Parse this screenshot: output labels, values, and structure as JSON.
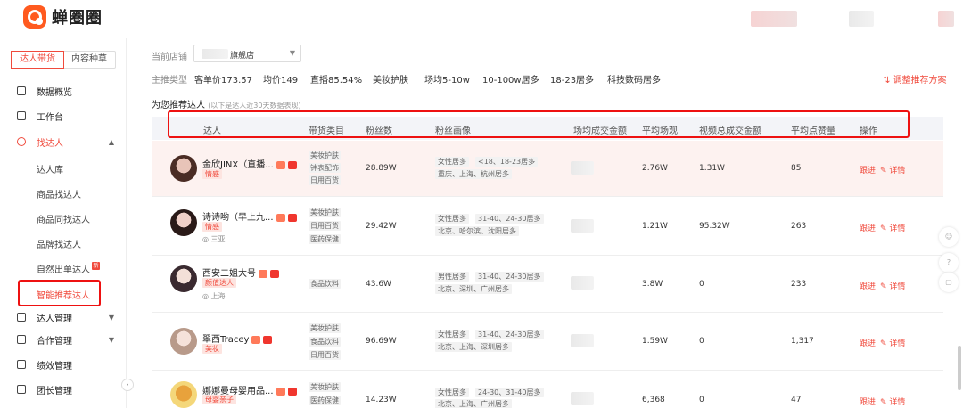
{
  "app": {
    "name": "蝉圈圈"
  },
  "sidebar": {
    "tabs": [
      "达人带货",
      "内容种草"
    ],
    "nav": [
      {
        "label": "数据概览",
        "icon": "gauge-icon"
      },
      {
        "label": "工作台",
        "icon": "monitor-icon"
      },
      {
        "label": "找达人",
        "icon": "search-person-icon"
      },
      {
        "label": "达人管理",
        "icon": "person-icon"
      },
      {
        "label": "合作管理",
        "icon": "cooperation-icon"
      },
      {
        "label": "绩效管理",
        "icon": "chart-icon"
      },
      {
        "label": "团长管理",
        "icon": "team-icon"
      }
    ],
    "sub": [
      "达人库",
      "商品找达人",
      "商品同找达人",
      "品牌找达人",
      "自然出单达人",
      "智能推荐达人"
    ],
    "sub_badge": "新"
  },
  "filters": {
    "store_label": "当前店铺",
    "store_value": "旗舰店",
    "main_label": "主推类型",
    "items": [
      "客单价173.57",
      "均价149",
      "直播85.54%",
      "美妆护肤",
      "场均5-10w",
      "10-100w居多",
      "18-23居多",
      "科技数码居多"
    ],
    "adjust_link": "调整推荐方案"
  },
  "section": {
    "title": "为您推荐达人",
    "note": "(以下是达人近30天数据表现)"
  },
  "table": {
    "headers": [
      "达人",
      "带货类目",
      "粉丝数",
      "粉丝画像",
      "场均成交金额",
      "平均场观",
      "视频总成交金额",
      "平均点赞量",
      "操作"
    ],
    "rows": [
      {
        "name": "金欣JINX（直播...",
        "tag": "情感",
        "loc": "",
        "cats": [
          "美妆护肤",
          "钟表配饰",
          "日用百货"
        ],
        "fans": "28.89W",
        "fan1": [
          "女性居多",
          "<18、18-23居多"
        ],
        "fan2": [
          "重庆、上海、杭州居多"
        ],
        "avg_view": "2.76W",
        "video_gmv": "1.31W",
        "avg_like": "85"
      },
      {
        "name": "诗诗哟（早上九...",
        "tag": "情感",
        "loc": "三亚",
        "cats": [
          "美妆护肤",
          "日用百货",
          "医药保健"
        ],
        "fans": "29.42W",
        "fan1": [
          "女性居多",
          "31-40、24-30居多"
        ],
        "fan2": [
          "北京、哈尔滨、沈阳居多"
        ],
        "avg_view": "1.21W",
        "video_gmv": "95.32W",
        "avg_like": "263"
      },
      {
        "name": "西安二姐大号",
        "tag": "颜值达人",
        "loc": "上海",
        "cats": [
          "食品饮料"
        ],
        "fans": "43.6W",
        "fan1": [
          "男性居多",
          "31-40、24-30居多"
        ],
        "fan2": [
          "北京、深圳、广州居多"
        ],
        "avg_view": "3.8W",
        "video_gmv": "0",
        "avg_like": "233"
      },
      {
        "name": "翠西Tracey",
        "tag": "美妆",
        "loc": "",
        "cats": [
          "美妆护肤",
          "食品饮料",
          "日用百货"
        ],
        "fans": "96.69W",
        "fan1": [
          "女性居多",
          "31-40、24-30居多"
        ],
        "fan2": [
          "北京、上海、深圳居多"
        ],
        "avg_view": "1.59W",
        "video_gmv": "0",
        "avg_like": "1,317"
      },
      {
        "name": "娜娜曼母婴用品...",
        "tag": "母婴亲子",
        "loc": "",
        "cats": [
          "美妆护肤",
          "医药保健"
        ],
        "fans": "14.23W",
        "fan1": [
          "女性居多",
          "24-30、31-40居多"
        ],
        "fan2": [
          "北京、上海、广州居多"
        ],
        "avg_view": "6,368",
        "video_gmv": "0",
        "avg_like": "47"
      }
    ],
    "op_follow": "跟进",
    "op_detail": "详情"
  },
  "colors": {
    "accent": "#f04a3c",
    "annotation": "#e11111"
  }
}
